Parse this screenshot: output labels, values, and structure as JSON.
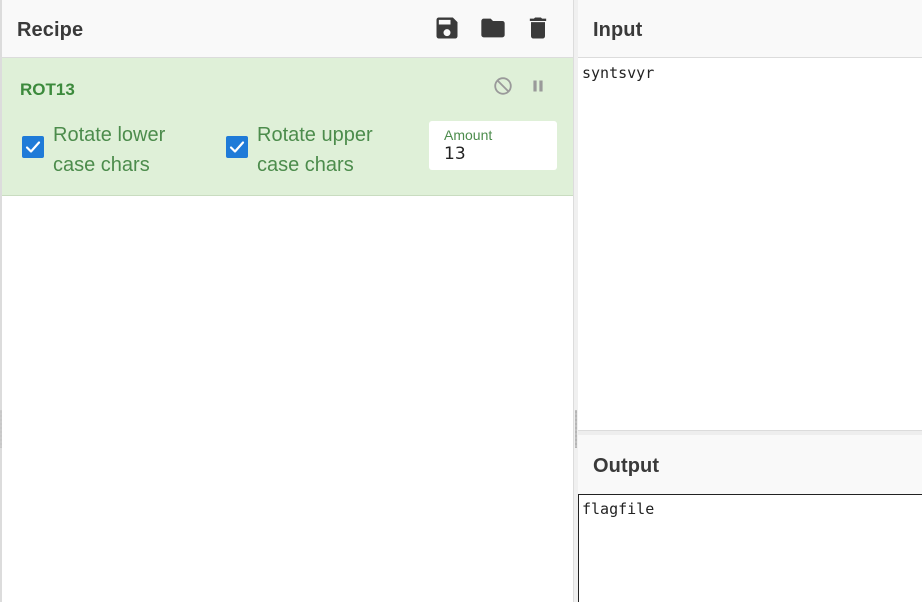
{
  "recipe": {
    "title": "Recipe",
    "actions": {
      "save": "save-icon",
      "open": "folder-icon",
      "clear": "trash-icon"
    },
    "operation": {
      "name": "ROT13",
      "disable_icon": "disable-icon",
      "breakpoint_icon": "pause-icon",
      "options": {
        "rotate_lower": {
          "label": "Rotate lower case chars",
          "checked": true
        },
        "rotate_upper": {
          "label": "Rotate upper case chars",
          "checked": true
        },
        "amount": {
          "label": "Amount",
          "value": "13"
        }
      }
    }
  },
  "input": {
    "title": "Input",
    "value": "syntsvyr"
  },
  "output": {
    "title": "Output",
    "value": "flagfile"
  },
  "colors": {
    "operation_bg": "#dff0d8",
    "operation_text": "#3c8a3c",
    "checkbox_accent": "#1f7bd8"
  }
}
